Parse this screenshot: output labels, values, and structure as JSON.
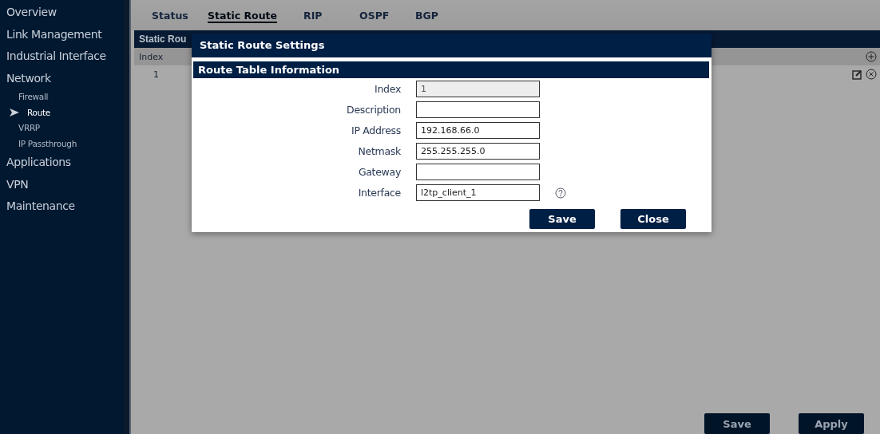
{
  "sidebar": {
    "items": [
      {
        "label": "Overview",
        "selected": false
      },
      {
        "label": "Link Management",
        "selected": false
      },
      {
        "label": "Industrial Interface",
        "selected": false
      },
      {
        "label": "Network",
        "selected": false,
        "children": [
          {
            "label": "Firewall",
            "selected": false
          },
          {
            "label": "Route",
            "selected": true
          },
          {
            "label": "VRRP",
            "selected": false
          },
          {
            "label": "IP Passthrough",
            "selected": false
          }
        ]
      },
      {
        "label": "Applications",
        "selected": false
      },
      {
        "label": "VPN",
        "selected": false
      },
      {
        "label": "Maintenance",
        "selected": false
      }
    ]
  },
  "tabs": [
    {
      "label": "Status",
      "selected": false
    },
    {
      "label": "Static Route",
      "selected": true
    },
    {
      "label": "RIP",
      "selected": false
    },
    {
      "label": "OSPF",
      "selected": false
    },
    {
      "label": "BGP",
      "selected": false
    }
  ],
  "panel": {
    "title": "Static Rou",
    "columns": [
      "Index"
    ],
    "rows": [
      [
        "1"
      ]
    ]
  },
  "buttons": [
    "Save",
    "Apply"
  ],
  "dialog": {
    "title": "Static Route Settings",
    "section": "Route Table Information",
    "fields": [
      {
        "label": "Index",
        "value": "1",
        "disabled": true,
        "help": false
      },
      {
        "label": "Description",
        "disabled": false,
        "help": false
      },
      {
        "label": "IP Address",
        "value": "192.168.66.0",
        "disabled": false,
        "help": false
      },
      {
        "label": "Netmask",
        "value": "255.255.255.0",
        "disabled": false,
        "help": false
      },
      {
        "label": "Gateway",
        "disabled": false,
        "help": false
      },
      {
        "label": "Interface",
        "value": "l2tp_client_1",
        "disabled": false,
        "help": true
      }
    ],
    "buttons": [
      "Save",
      "Close"
    ]
  }
}
